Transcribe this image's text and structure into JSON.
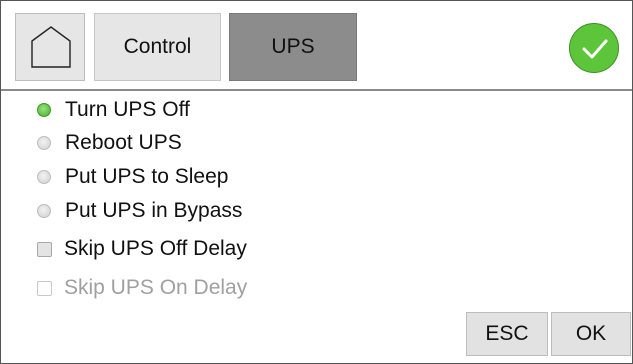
{
  "header": {
    "home_icon": "home-icon",
    "tabs": [
      {
        "label": "Control",
        "active": false
      },
      {
        "label": "UPS",
        "active": true
      }
    ],
    "status_icon": "checkmark-icon",
    "status_color": "#5cc53a"
  },
  "options": {
    "radios": [
      {
        "label": "Turn UPS Off",
        "selected": true
      },
      {
        "label": "Reboot UPS",
        "selected": false
      },
      {
        "label": "Put UPS to Sleep",
        "selected": false
      },
      {
        "label": "Put UPS in Bypass",
        "selected": false
      }
    ],
    "checkboxes": [
      {
        "label": "Skip UPS Off Delay",
        "checked": false,
        "enabled": true
      },
      {
        "label": "Skip UPS On Delay",
        "checked": false,
        "enabled": false
      }
    ]
  },
  "buttons": {
    "esc_label": "ESC",
    "ok_label": "OK"
  }
}
